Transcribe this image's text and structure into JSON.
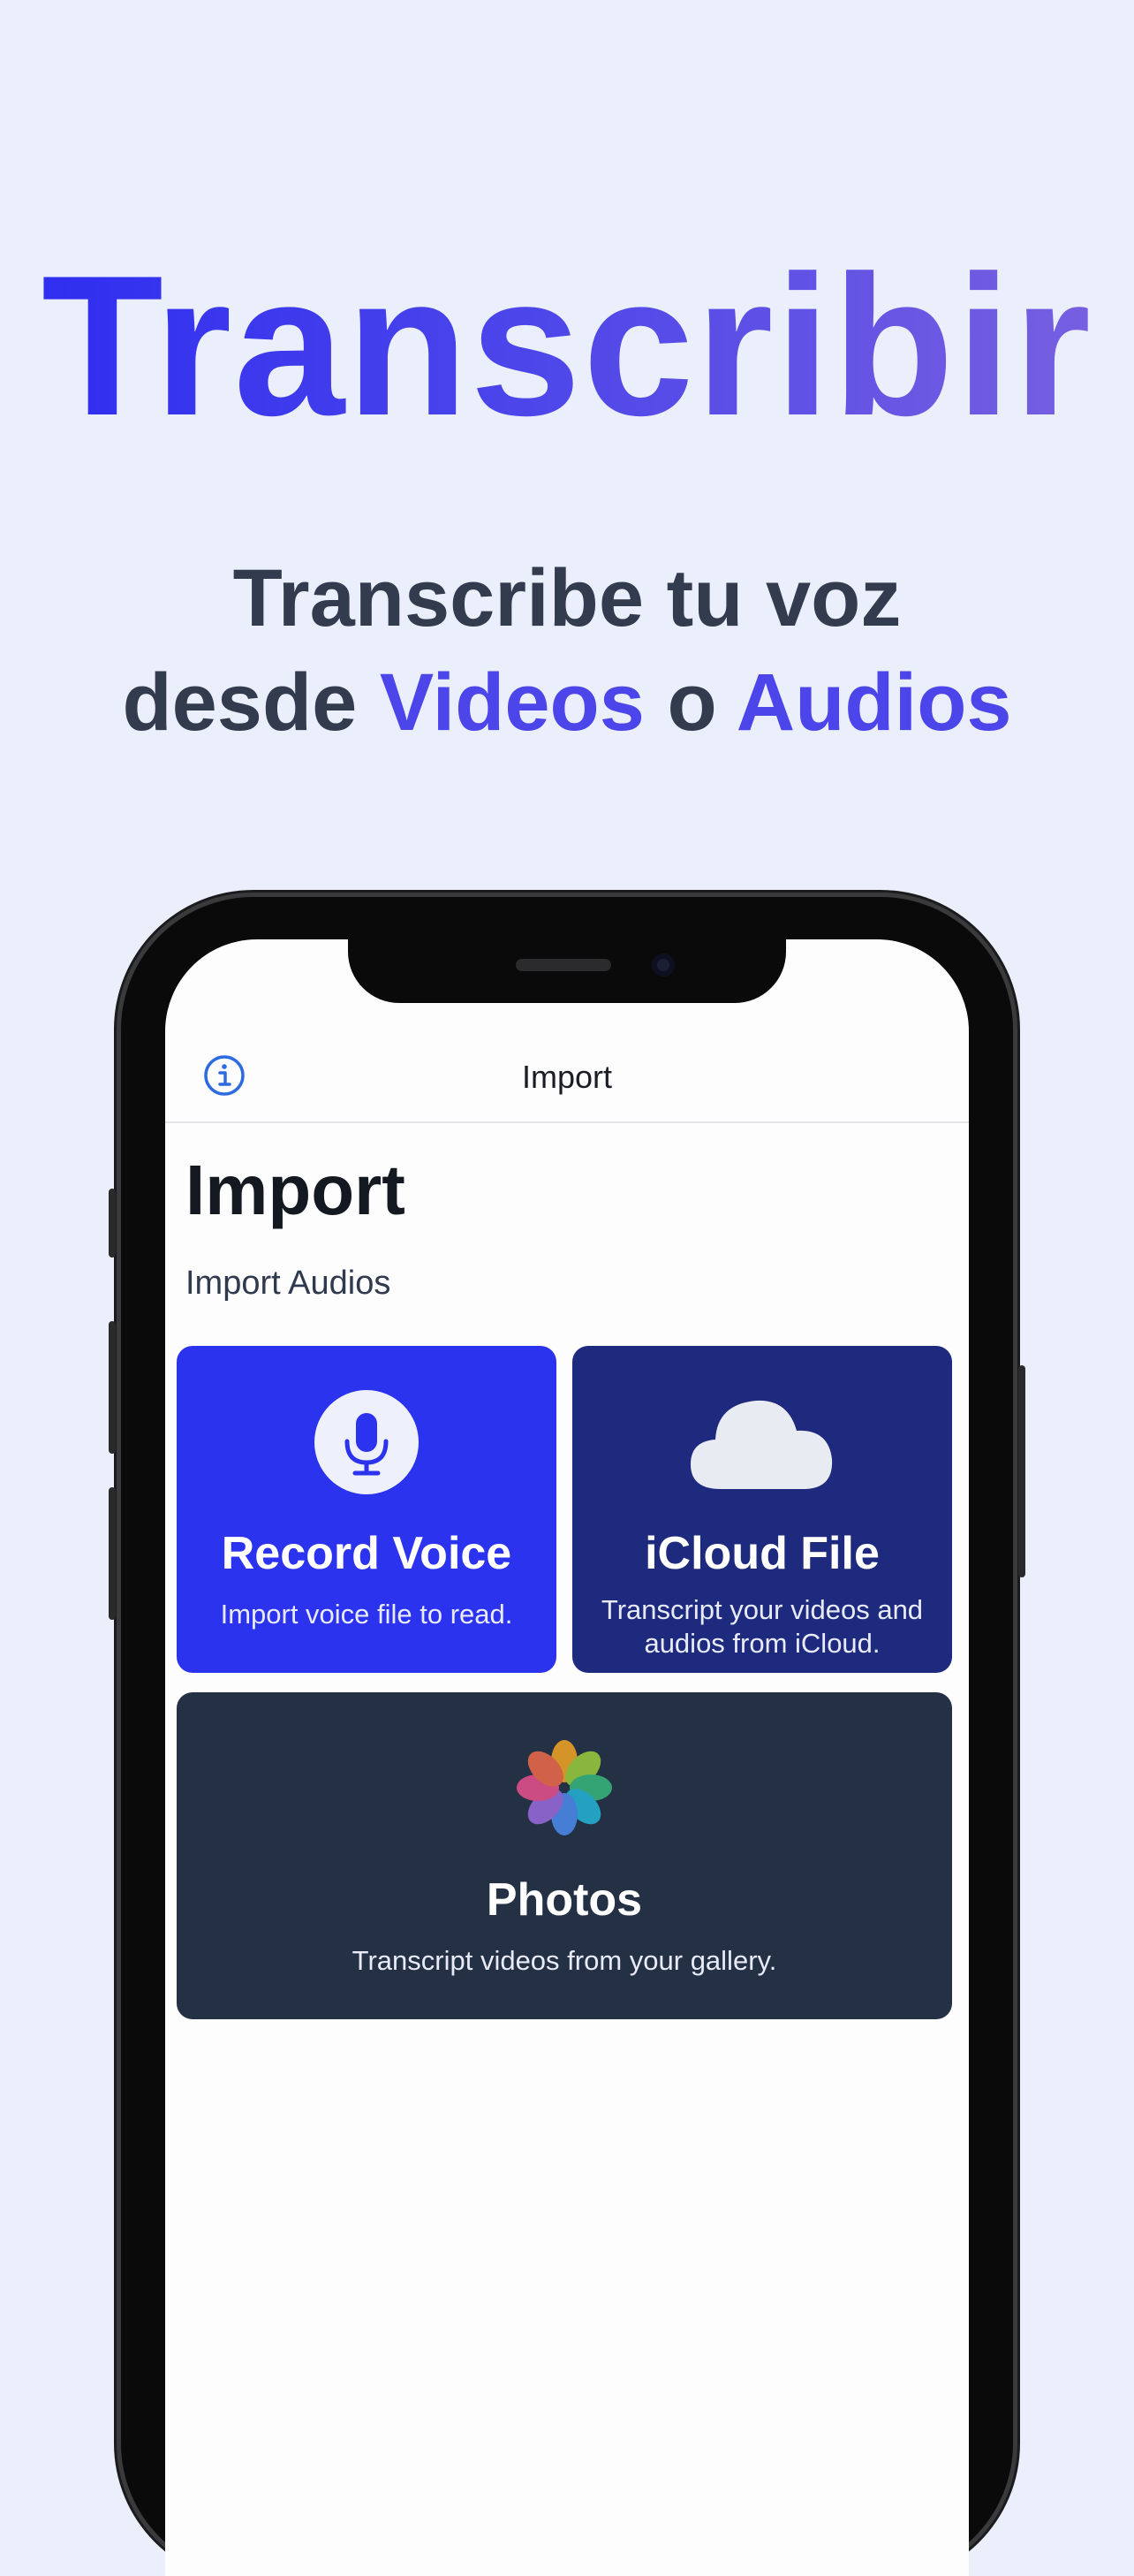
{
  "hero": {
    "title": "Transcribir",
    "subtitle_line1": "Transcribe tu voz",
    "subtitle_line2_pre": "desde ",
    "subtitle_line2_accent1": "Videos",
    "subtitle_line2_mid": " o ",
    "subtitle_line2_accent2": "Audios"
  },
  "status_bar": {
    "time": "",
    "icons": ""
  },
  "navbar": {
    "title": "Import",
    "info_icon": "info-circle-icon"
  },
  "page": {
    "title": "Import",
    "subtitle": "Import Audios"
  },
  "cards": [
    {
      "icon": "microphone-icon",
      "title": "Record Voice",
      "description": "Import voice file to read."
    },
    {
      "icon": "cloud-icon",
      "title": "iCloud File",
      "description": "Transcript your videos and audios from iCloud."
    },
    {
      "icon": "photos-flower-icon",
      "title": "Photos",
      "description": "Transcript videos from your gallery."
    }
  ],
  "colors": {
    "background": "#eaeffb",
    "accent": "#4b45ea",
    "record_card": "#2c33ef",
    "icloud_card": "#1e2a7e",
    "photos_card": "#243044"
  }
}
